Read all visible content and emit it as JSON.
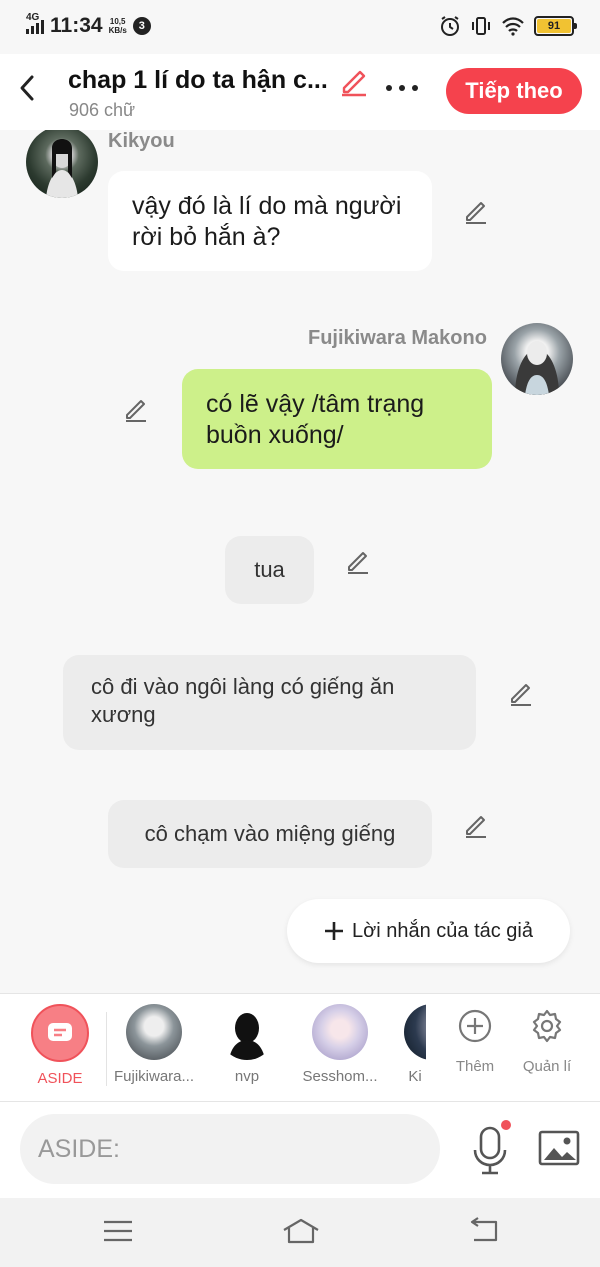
{
  "status_bar": {
    "network": "4G",
    "time": "11:34",
    "speed_value": "10,5",
    "speed_unit": "KB/s",
    "notification_count": "3",
    "battery": "91"
  },
  "header": {
    "title": "chap 1 lí do ta hận c...",
    "word_count": "906 chữ",
    "next_label": "Tiếp theo"
  },
  "messages": [
    {
      "speaker": "Kikyou",
      "text": "vậy đó là lí do mà người rời bỏ hắn à?"
    },
    {
      "speaker": "Fujikiwara Makono",
      "text": "có lẽ vậy /tâm trạng buồn xuống/"
    },
    {
      "text": "tua"
    },
    {
      "text": "cô đi vào ngôi làng có giếng ăn xương"
    },
    {
      "text": "cô chạm vào miệng giếng"
    }
  ],
  "author_note_label": "Lời nhắn của tác giả",
  "characters": [
    {
      "label": "ASIDE"
    },
    {
      "label": "Fujikiwara..."
    },
    {
      "label": "nvp"
    },
    {
      "label": "Sesshom..."
    },
    {
      "label": "Ki"
    }
  ],
  "tools": {
    "add_label": "Thêm",
    "manage_label": "Quản lí"
  },
  "input": {
    "placeholder": "ASIDE:"
  },
  "colors": {
    "accent": "#f5424d",
    "green_bubble": "#cdf08a"
  }
}
